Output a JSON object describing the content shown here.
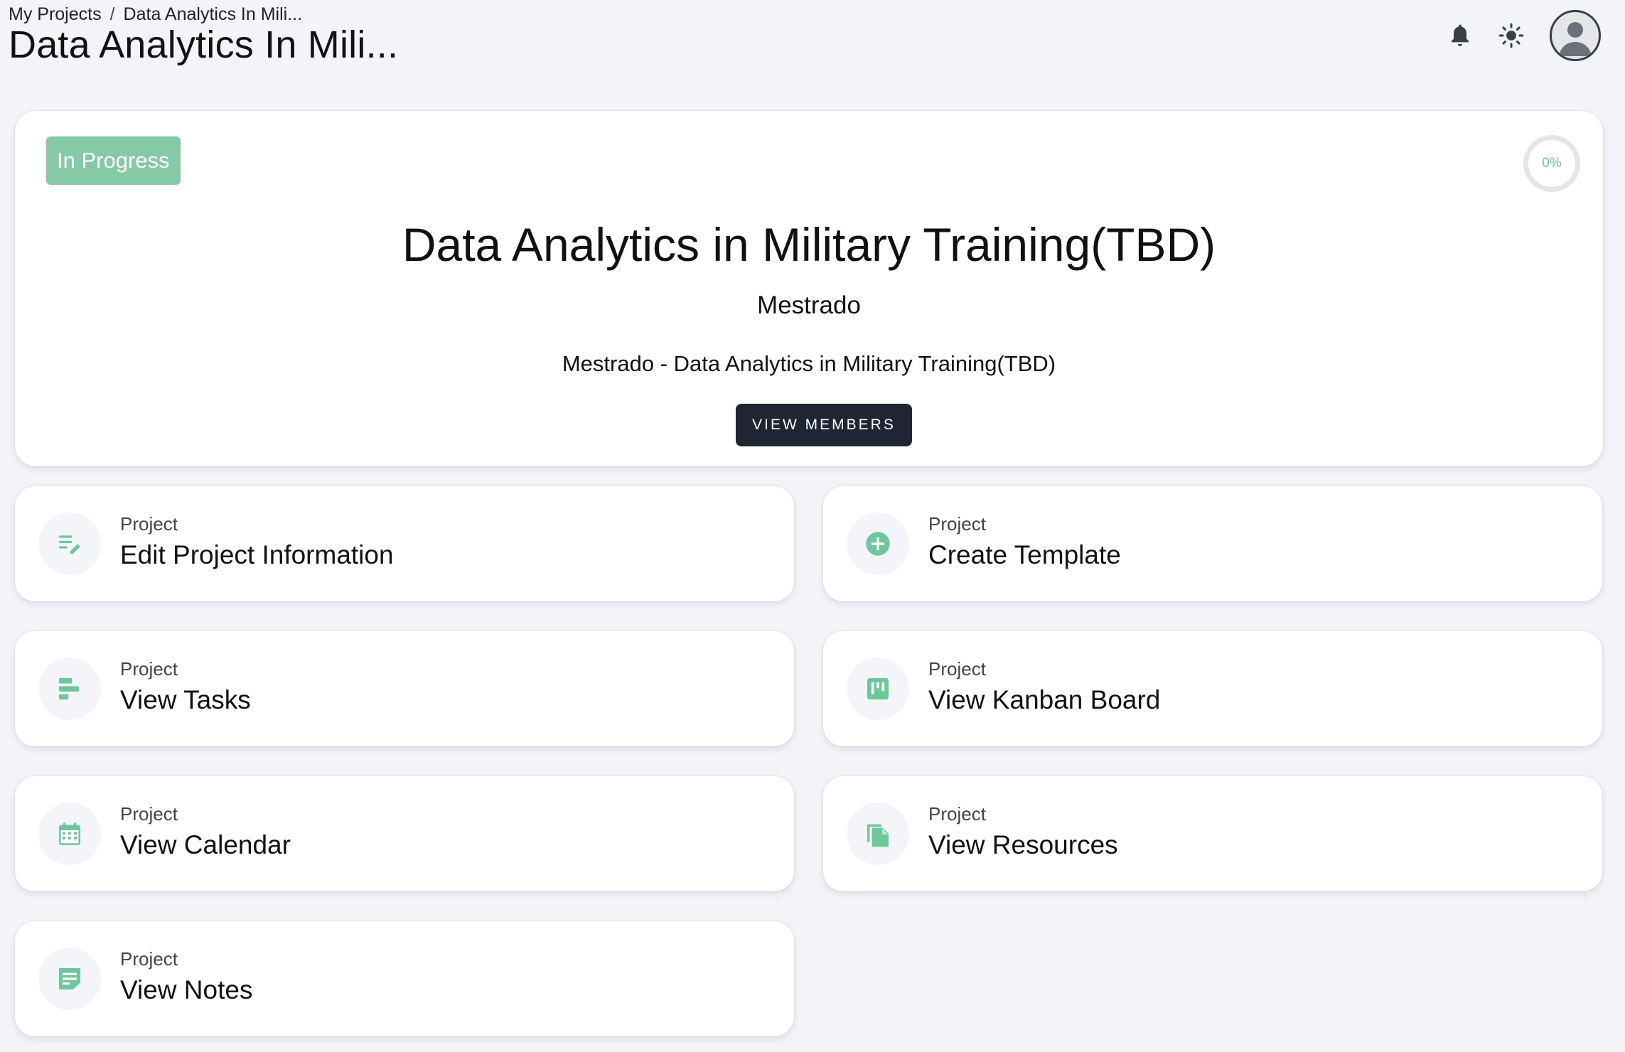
{
  "breadcrumb": {
    "root": "My Projects",
    "separator": "/",
    "current": "Data Analytics In Mili..."
  },
  "page_title": "Data Analytics In Mili...",
  "header": {
    "icons": [
      "bell-icon",
      "sun-icon",
      "user-avatar-icon"
    ]
  },
  "project": {
    "status": "In Progress",
    "progress_label": "0%",
    "progress_value": 0,
    "title": "Data Analytics in Military Training(TBD)",
    "subtitle": "Mestrado",
    "description": "Mestrado - Data Analytics in Military Training(TBD)",
    "view_members_label": "VIEW MEMBERS"
  },
  "cards": [
    {
      "kicker": "Project",
      "title": "Edit Project Information",
      "icon": "edit-notes-icon"
    },
    {
      "kicker": "Project",
      "title": "Create Template",
      "icon": "add-circle-icon"
    },
    {
      "kicker": "Project",
      "title": "View Tasks",
      "icon": "task-bars-icon"
    },
    {
      "kicker": "Project",
      "title": "View Kanban Board",
      "icon": "kanban-icon"
    },
    {
      "kicker": "Project",
      "title": "View Calendar",
      "icon": "calendar-icon"
    },
    {
      "kicker": "Project",
      "title": "View Resources",
      "icon": "documents-icon"
    },
    {
      "kicker": "Project",
      "title": "View Notes",
      "icon": "note-icon"
    }
  ],
  "colors": {
    "accent": "#6cc79a",
    "badge": "#84cba5",
    "button": "#1f2633",
    "background": "#f2f4f8"
  }
}
